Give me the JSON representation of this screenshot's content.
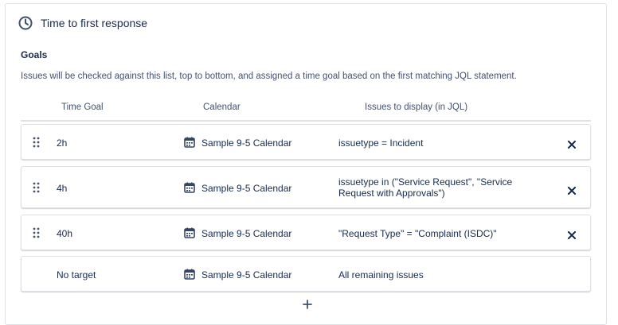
{
  "header": {
    "title": "Time to first response",
    "icon": "clock-icon"
  },
  "goals": {
    "label": "Goals",
    "description": "Issues will be checked against this list, top to bottom, and assigned a time goal based on the first matching JQL statement."
  },
  "table": {
    "columns": {
      "time_goal": "Time Goal",
      "calendar": "Calendar",
      "jql": "Issues to display (in JQL)"
    },
    "rows": [
      {
        "goal": "2h",
        "calendar": "Sample 9-5 Calendar",
        "jql": "issuetype = Incident"
      },
      {
        "goal": "4h",
        "calendar": "Sample 9-5 Calendar",
        "jql": "issuetype in (\"Service Request\", \"Service Request with Approvals\")"
      },
      {
        "goal": "40h",
        "calendar": "Sample 9-5 Calendar",
        "jql": "\"Request Type\" = \"Complaint (ISDC)\""
      },
      {
        "goal": "No target",
        "calendar": "Sample 9-5 Calendar",
        "jql": "All remaining issues"
      }
    ]
  },
  "add_button": {
    "label": "+"
  },
  "colors": {
    "text": "#172b4d",
    "subtle": "#42526e",
    "border": "#dfe1e6"
  }
}
